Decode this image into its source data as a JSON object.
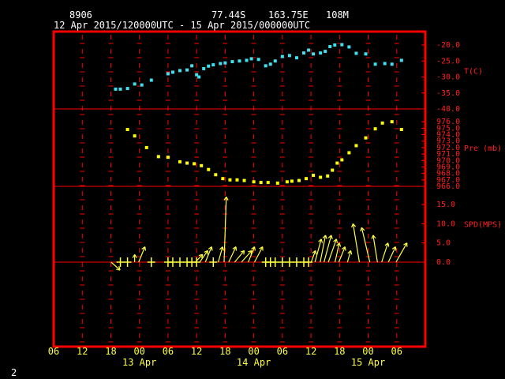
{
  "header": {
    "station_id": "8906",
    "latitude": "77.44S",
    "longitude": "163.75E",
    "elevation": "108M",
    "time_range": "12 Apr 2015/120000UTC - 15 Apr 2015/000000UTC",
    "page_number": "2"
  },
  "colors": {
    "frame": "#ff0000",
    "temperature": "#40e0f0",
    "pressure": "#ffff00",
    "wind": "#ffff40",
    "axis_text": "#ff2020",
    "time_text": "#ffff40"
  },
  "chart_data": [
    {
      "type": "scatter",
      "ylabel": "T(C)",
      "ylim": [
        -40,
        -20
      ],
      "yticks": [
        "-20.0",
        "-25.0",
        "-30.0",
        "-35.0",
        "-40.0"
      ],
      "x_hours": [
        13,
        14,
        15.5,
        17,
        18.5,
        20.5,
        24,
        25,
        26.5,
        28,
        29,
        30,
        30.5,
        31.5,
        32.5,
        33.5,
        35,
        36,
        37.5,
        39,
        40.5,
        41.5,
        43,
        44.5,
        45.5,
        46.5,
        48,
        49.5,
        51,
        52.5,
        53.5,
        54.5,
        56,
        57,
        58,
        59,
        60.5,
        62,
        63.5,
        65.5,
        67.5,
        69.5,
        71,
        73
      ],
      "values": [
        -33.8,
        -33.8,
        -33.6,
        -32.2,
        -32.5,
        -31.0,
        -29.0,
        -28.5,
        -28.0,
        -27.8,
        -26.5,
        -29.3,
        -30.0,
        -27.4,
        -26.6,
        -26.2,
        -25.8,
        -25.6,
        -25.2,
        -25.0,
        -24.8,
        -24.3,
        -24.5,
        -26.5,
        -26.0,
        -25.0,
        -23.6,
        -23.3,
        -24.0,
        -22.5,
        -21.6,
        -22.8,
        -22.5,
        -22.0,
        -20.5,
        -20.0,
        -19.9,
        -20.6,
        -22.6,
        -22.8,
        -26.0,
        -25.8,
        -26.0,
        -24.8
      ]
    },
    {
      "type": "scatter",
      "ylabel": "Pre (mb)",
      "ylim": [
        966,
        977
      ],
      "yticks": [
        "976.0",
        "975.0",
        "974.0",
        "973.0",
        "972.0",
        "971.0",
        "970.0",
        "969.0",
        "968.0",
        "967.0",
        "966.0"
      ],
      "x_hours": [
        15.5,
        17,
        19.5,
        22,
        24,
        26.5,
        28,
        29.5,
        31,
        32.5,
        34,
        35.5,
        37,
        38.5,
        40,
        42,
        43.5,
        45,
        47,
        49,
        50,
        51.5,
        53,
        54.5,
        56,
        57.5,
        58.5,
        59.5,
        60.5,
        62,
        63.5,
        65.5,
        67.5,
        69,
        71,
        73
      ],
      "values": [
        974.8,
        973.8,
        972.0,
        970.6,
        970.5,
        969.8,
        969.6,
        969.5,
        969.2,
        968.6,
        967.8,
        967.2,
        967.0,
        967.0,
        966.9,
        966.7,
        966.6,
        966.6,
        966.5,
        966.7,
        966.8,
        966.9,
        967.2,
        967.7,
        967.4,
        967.6,
        968.5,
        969.6,
        970.1,
        971.2,
        972.3,
        973.5,
        974.9,
        975.8,
        976.0,
        974.8
      ]
    },
    {
      "type": "scatter",
      "ylabel": "SPD(MPS)",
      "ylim": [
        0,
        15
      ],
      "yticks": [
        "15.0",
        "10.0",
        "5.0",
        "0.0"
      ],
      "x_hours": [
        13,
        14,
        15.5,
        17,
        18.5,
        20.5,
        24,
        25,
        26.5,
        28,
        29,
        30,
        30.5,
        31.5,
        32.5,
        33.5,
        35,
        36,
        37.5,
        39,
        40.5,
        41.5,
        43,
        44.5,
        45.5,
        46.5,
        48,
        49.5,
        51,
        52.5,
        53.5,
        54.5,
        55.5,
        56.5,
        57.5,
        58.5,
        59.5,
        60.5,
        62,
        63.5,
        65.5,
        67.5,
        69.5,
        71,
        73
      ],
      "speeds": [
        3.0,
        0.5,
        0.5,
        2.0,
        4.0,
        0.5,
        0.5,
        0.5,
        0.5,
        0.5,
        0.5,
        1.0,
        2.0,
        3.0,
        4.0,
        0.5,
        4.0,
        17.0,
        4.0,
        3.0,
        3.0,
        4.0,
        4.0,
        1.0,
        0.5,
        0.5,
        1.0,
        0.5,
        1.0,
        1.0,
        1.0,
        3.0,
        6.0,
        7.0,
        7.0,
        6.0,
        5.0,
        4.0,
        3.0,
        10.0,
        9.0,
        7.0,
        5.0,
        4.0,
        5.0
      ],
      "dirs_deg": [
        135,
        0,
        0,
        0,
        30,
        0,
        0,
        0,
        0,
        0,
        0,
        0,
        35,
        40,
        30,
        0,
        20,
        10,
        35,
        50,
        55,
        30,
        40,
        160,
        0,
        0,
        150,
        0,
        140,
        140,
        150,
        20,
        30,
        25,
        35,
        40,
        20,
        30,
        15,
        330,
        320,
        340,
        30,
        35,
        60
      ]
    }
  ],
  "time_axis": {
    "tick_labels": [
      "06",
      "12",
      "18",
      "00",
      "06",
      "12",
      "18",
      "00",
      "06",
      "12",
      "18",
      "00",
      "06"
    ],
    "date_labels": [
      "13 Apr",
      "14 Apr",
      "15 Apr"
    ]
  }
}
